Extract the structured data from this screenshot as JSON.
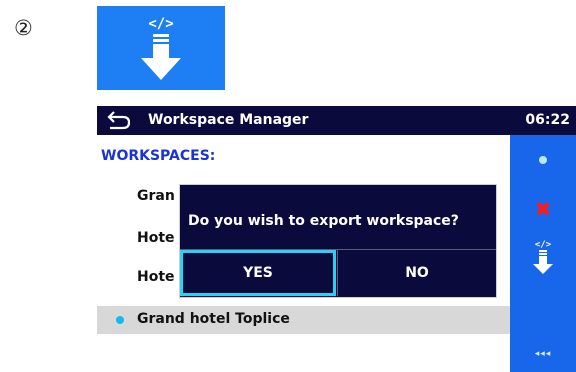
{
  "annotation": {
    "step_marker": "②"
  },
  "colors": {
    "titlebar_bg": "#0a0a3c",
    "sidebar_bg": "#1866ea",
    "heading_color": "#1a33d6",
    "selection_bg": "#d8d8d8",
    "accent_cyan": "#2ad1f3",
    "cancel_red": "#ff1a1a"
  },
  "big_icon": {
    "name": "export-workspace-icon"
  },
  "titlebar": {
    "back_icon": "back-arrow-icon",
    "title": "Workspace Manager",
    "time": "06:22"
  },
  "list": {
    "heading": "WORKSPACES:",
    "items": [
      "Gran",
      "Hote",
      "Hote"
    ],
    "selected": "Grand hotel Toplice"
  },
  "sidebar": {
    "buttons": [
      {
        "icon": "select-dot-icon"
      },
      {
        "icon": "delete-x-icon",
        "label": "✖"
      },
      {
        "icon": "export-icon"
      },
      {
        "icon": "more-options-icon",
        "label": "◂◂◂"
      }
    ]
  },
  "dialog": {
    "message": "Do you wish to export workspace?",
    "yes": "YES",
    "no": "NO"
  }
}
